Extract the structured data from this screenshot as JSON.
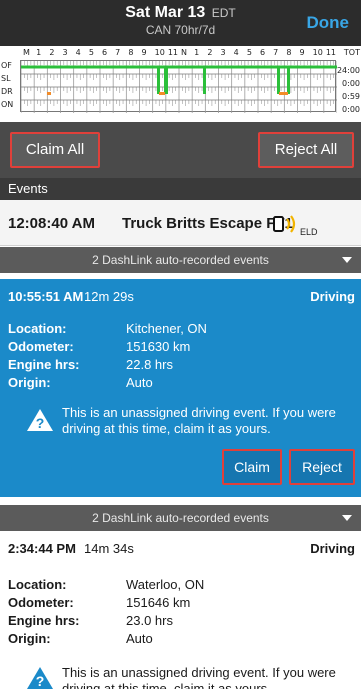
{
  "header": {
    "date": "Sat Mar 13",
    "timezone": "EDT",
    "cycle": "CAN 70hr/7d",
    "done_label": "Done"
  },
  "graph": {
    "hour_labels": [
      "M",
      "1",
      "2",
      "3",
      "4",
      "5",
      "6",
      "7",
      "8",
      "9",
      "10",
      "11",
      "N",
      "1",
      "2",
      "3",
      "4",
      "5",
      "6",
      "7",
      "8",
      "9",
      "10",
      "11"
    ],
    "total_label": "TOT",
    "rows": [
      {
        "label": "OF",
        "total": "24:00"
      },
      {
        "label": "SL",
        "total": "0:00"
      },
      {
        "label": "DR",
        "total": "0:59"
      },
      {
        "label": "ON",
        "total": "0:00"
      }
    ]
  },
  "actions": {
    "claim_all": "Claim All",
    "reject_all": "Reject All"
  },
  "section_title": "Events",
  "first_event": {
    "time": "12:08:40 AM",
    "label": "Truck Britts Escape FT1",
    "badge": "ELD"
  },
  "dashlink_label": "2 DashLink auto-recorded events",
  "events": [
    {
      "time": "10:55:51 AM",
      "duration": "12m 29s",
      "status": "Driving",
      "location": "Kitchener, ON",
      "odometer": "151630 km",
      "engine_hrs": "22.8 hrs",
      "origin": "Auto",
      "warning": "This is an unassigned driving event. If you were driving at this time, claim it as yours.",
      "claim": "Claim",
      "reject": "Reject"
    },
    {
      "time": "2:34:44 PM",
      "duration": "14m 34s",
      "status": "Driving",
      "location": "Waterloo, ON",
      "odometer": "151646 km",
      "engine_hrs": "23.0 hrs",
      "origin": "Auto",
      "warning": "This is an unassigned driving event. If you were driving at this time, claim it as yours."
    }
  ],
  "labels": {
    "location": "Location:",
    "odometer": "Odometer:",
    "engine_hrs": "Engine hrs:",
    "origin": "Origin:"
  },
  "colors": {
    "accent": "#39a6e6",
    "selected_card": "#1b8ac9",
    "highlight_border": "#e0403a",
    "driving_line": "#2bbf3a",
    "sleeper_line": "#f28c28"
  }
}
